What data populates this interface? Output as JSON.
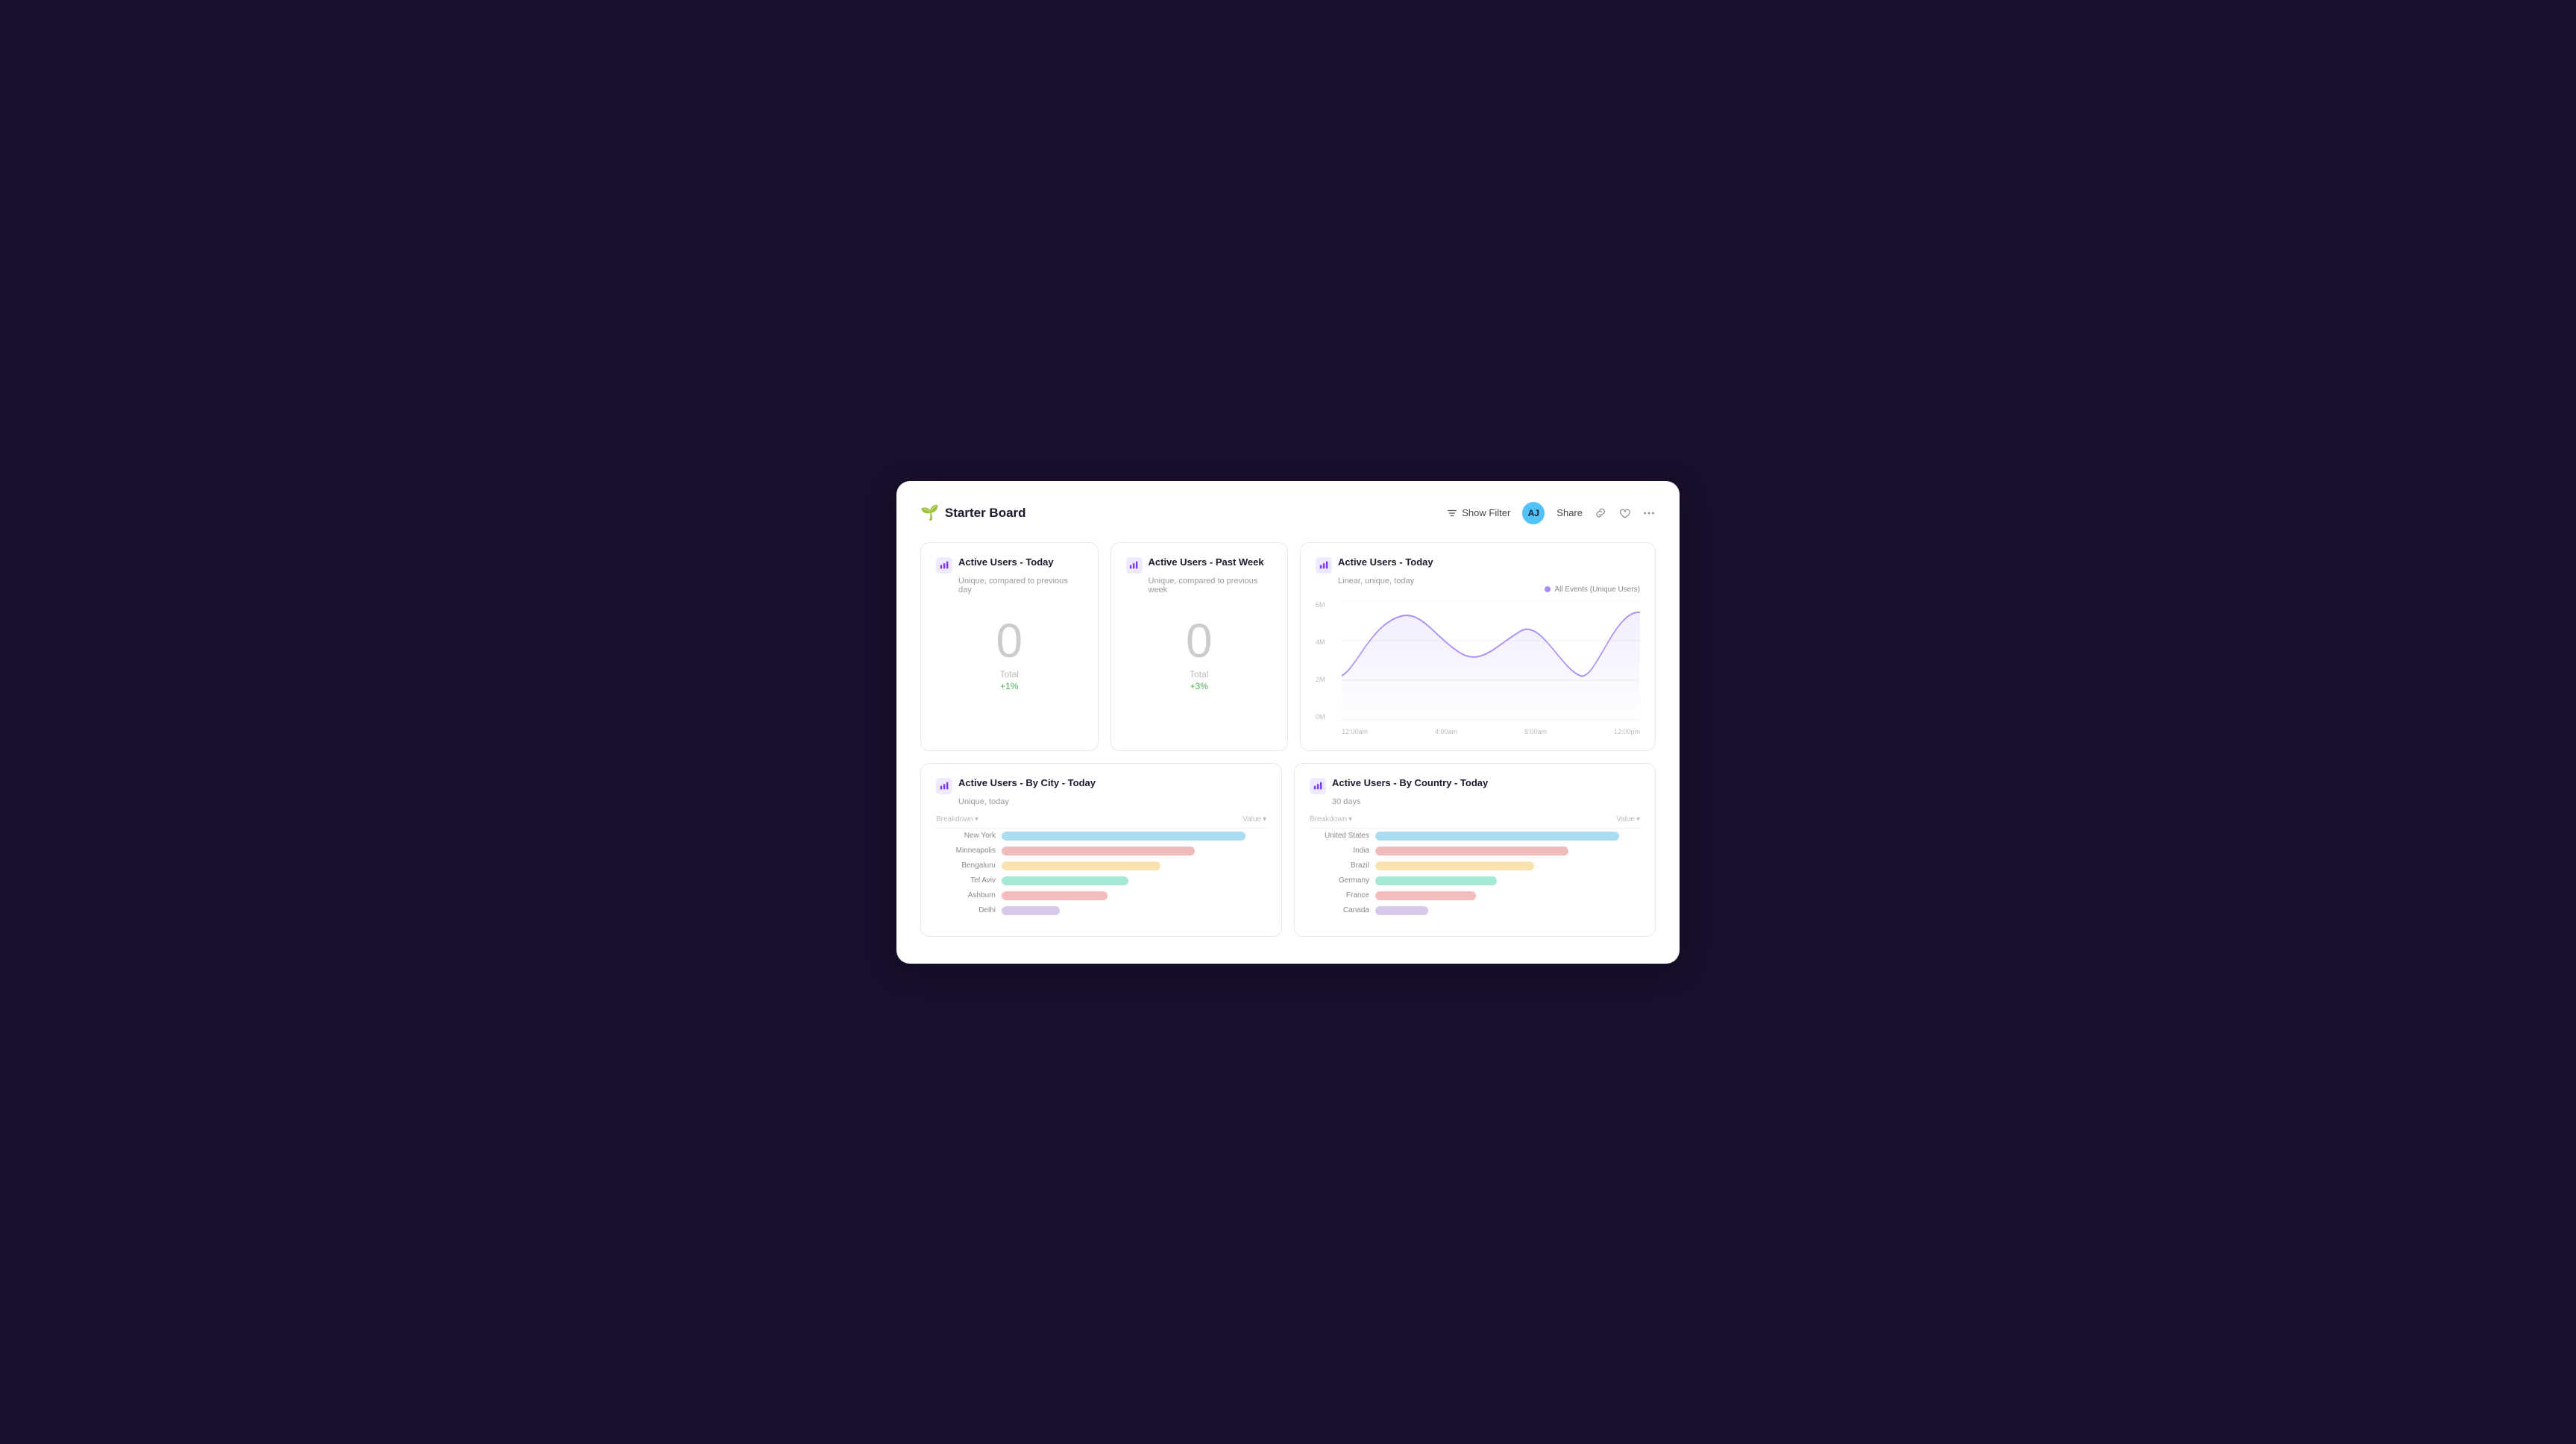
{
  "brand": {
    "icon": "🌱",
    "title": "Starter Board"
  },
  "header": {
    "show_filter_label": "Show Filter",
    "avatar_initials": "AJ",
    "share_label": "Share"
  },
  "cards": {
    "active_users_today": {
      "title": "Active Users - Today",
      "subtitle": "Unique, compared to previous day",
      "value": "0",
      "total_label": "Total",
      "change": "+1%"
    },
    "active_users_past_week": {
      "title": "Active Users - Past Week",
      "subtitle": "Unique, compared to previous week",
      "value": "0",
      "total_label": "Total",
      "change": "+3%"
    },
    "active_users_today_linear": {
      "title": "Active Users - Today",
      "subtitle": "Linear, unique, today",
      "legend_label": "All Events (Unique Users)",
      "y_labels": [
        "6M",
        "4M",
        "2M",
        "0M"
      ],
      "x_labels": [
        "12:00am",
        "4:00am",
        "8:00am",
        "12:00pm"
      ],
      "chart_color": "#a78bfa"
    },
    "active_users_by_city": {
      "title": "Active Users - By City - Today",
      "subtitle": "Unique, today",
      "breakdown_label": "Breakdown",
      "value_label": "Value",
      "rows": [
        {
          "label": "New York",
          "pct": 92,
          "color": "#87ceeb"
        },
        {
          "label": "Minneapolis",
          "pct": 73,
          "color": "#e8a0a0"
        },
        {
          "label": "Bengaluru",
          "pct": 60,
          "color": "#f5d78e"
        },
        {
          "label": "Tel Aviv",
          "pct": 48,
          "color": "#7ddfc3"
        },
        {
          "label": "Ashburn",
          "pct": 40,
          "color": "#f0a0a0"
        },
        {
          "label": "Delhi",
          "pct": 22,
          "color": "#c3b1e1"
        }
      ]
    },
    "active_users_by_country": {
      "title": "Active Users - By Country - Today",
      "subtitle": "30 days",
      "breakdown_label": "Breakdown",
      "value_label": "Value",
      "rows": [
        {
          "label": "United States",
          "pct": 92,
          "color": "#87ceeb"
        },
        {
          "label": "India",
          "pct": 73,
          "color": "#e8a0a0"
        },
        {
          "label": "Brazil",
          "pct": 60,
          "color": "#f5d78e"
        },
        {
          "label": "Germany",
          "pct": 46,
          "color": "#7ddfc3"
        },
        {
          "label": "France",
          "pct": 38,
          "color": "#f0a0a0"
        },
        {
          "label": "Canada",
          "pct": 20,
          "color": "#c3b1e1"
        }
      ]
    }
  },
  "icons": {
    "filter": "⊟",
    "link": "🔗",
    "heart": "♡",
    "more": "···"
  }
}
